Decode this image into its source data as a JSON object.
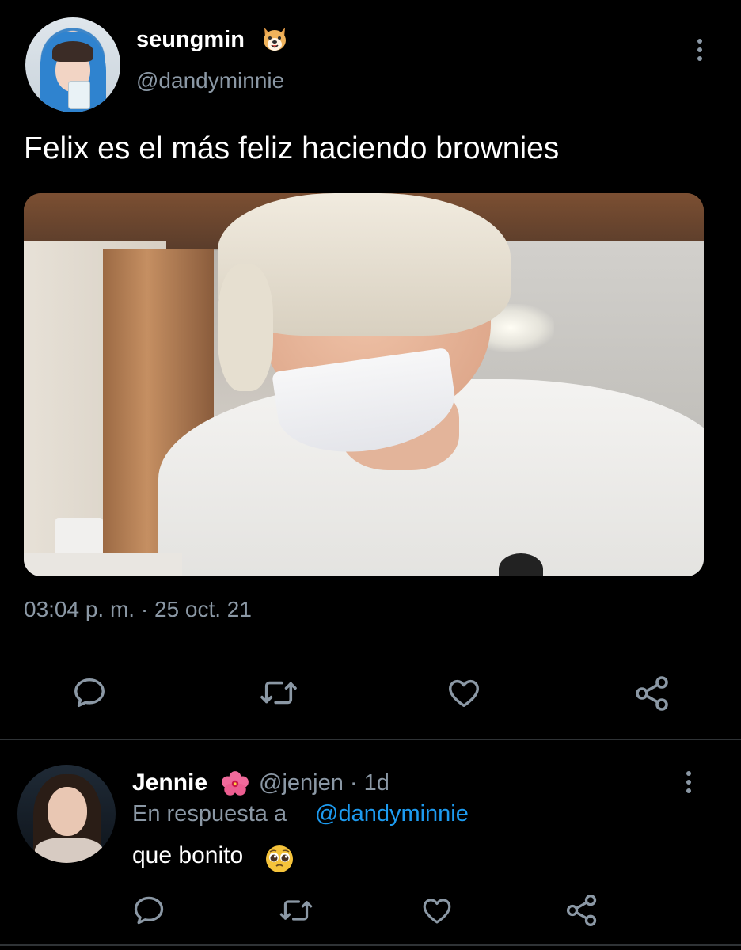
{
  "tweet": {
    "display_name": "seungmin",
    "name_emoji": "dog-face-emoji",
    "handle": "@dandyminnie",
    "text": "Felix es el más feliz haciendo brownies",
    "timestamp": "03:04 p. m. · 25 oct. 21",
    "more_icon": "more-vertical-icon",
    "actions": [
      "reply-icon",
      "retweet-icon",
      "like-icon",
      "share-icon"
    ]
  },
  "reply": {
    "display_name": "Jennie",
    "name_emoji": "hibiscus-emoji",
    "handle_time": "@jenjen · 1d",
    "reply_to_label": "En respuesta a",
    "reply_to_handle": "@dandyminnie",
    "text": "que bonito",
    "text_emoji": "pleading-face-emoji",
    "more_icon": "more-vertical-icon",
    "actions": [
      "reply-icon",
      "retweet-icon",
      "like-icon",
      "share-icon"
    ]
  },
  "colors": {
    "background": "#000000",
    "primary_text": "#ffffff",
    "secondary_text": "#8b98a5",
    "link": "#1d9bf0",
    "divider": "#2f3336"
  }
}
